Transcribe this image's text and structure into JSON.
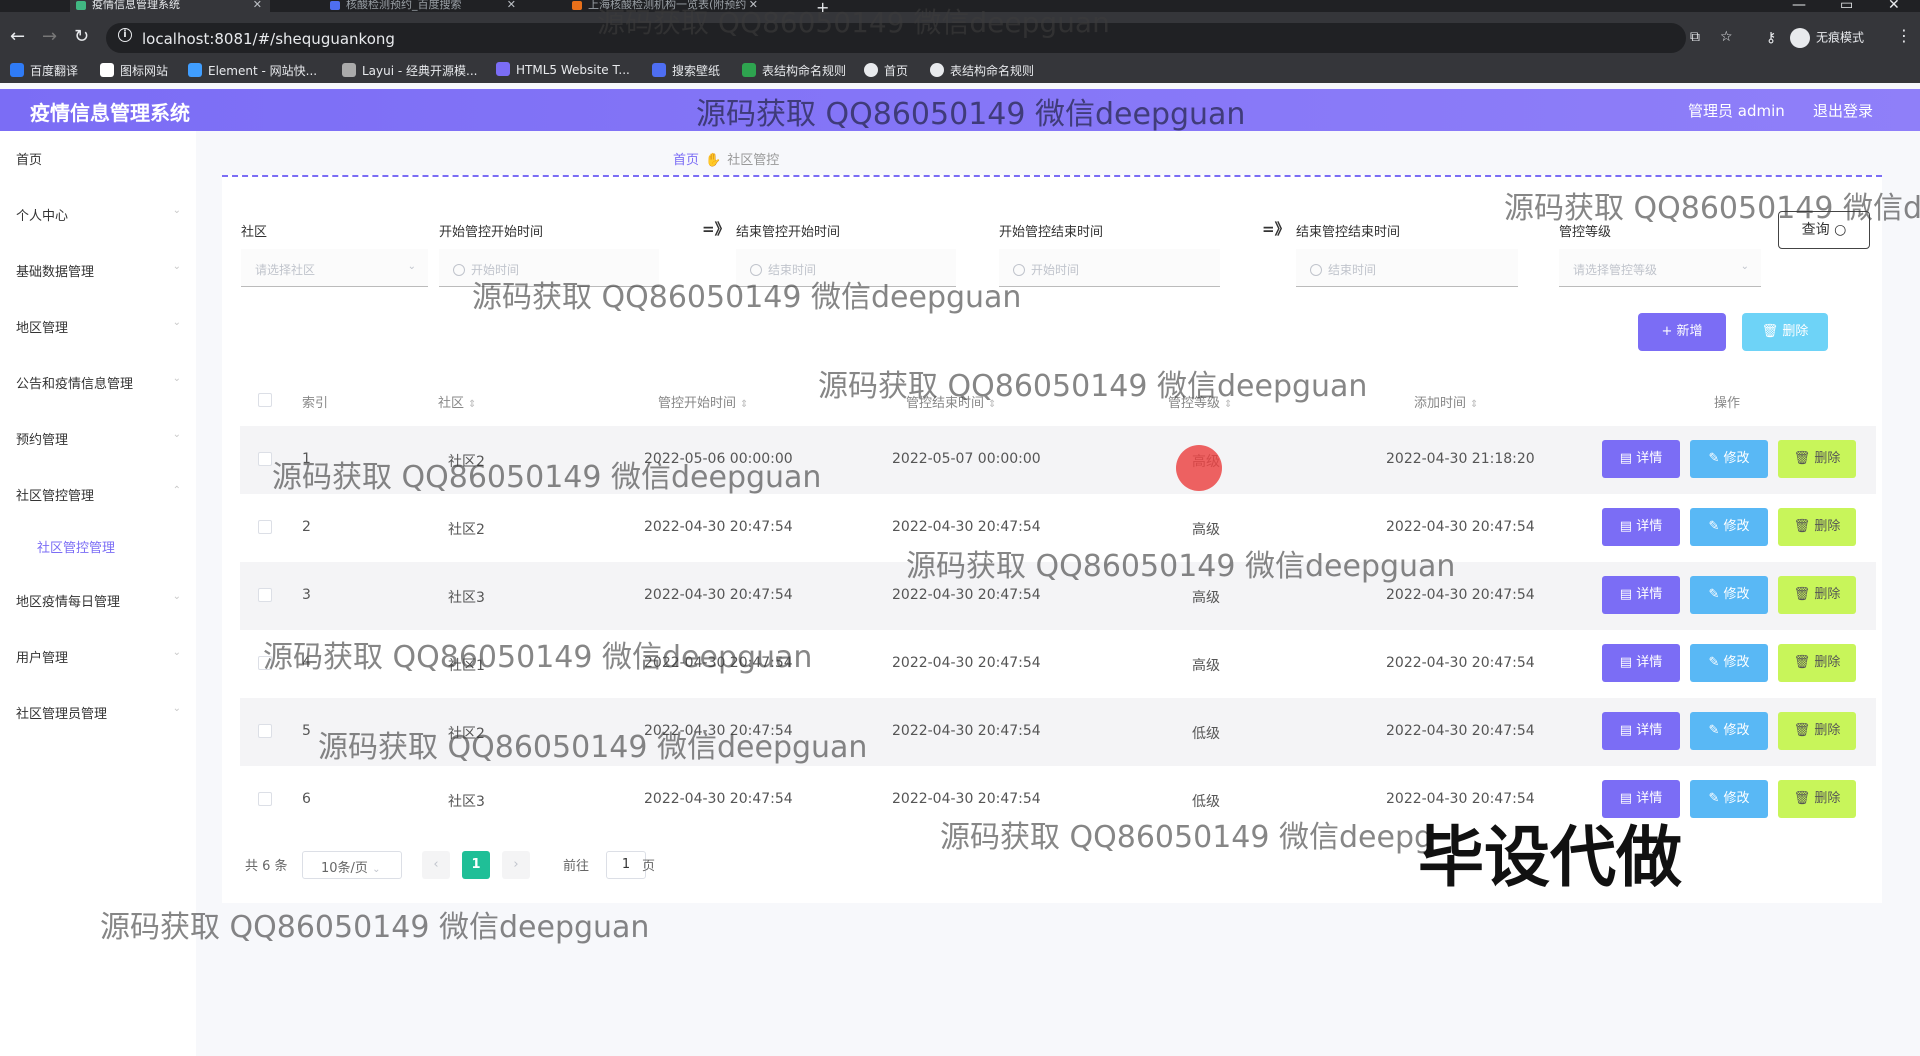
{
  "browser": {
    "tabs": [
      {
        "title": "疫情信息管理系统",
        "active": true
      },
      {
        "title": "核酸检测预约_百度搜索",
        "active": false
      },
      {
        "title": "上海核酸检测机构一览表(附预约",
        "active": false
      }
    ],
    "url": "localhost:8081/#/shequguankong",
    "incognito_label": "无痕模式",
    "bookmarks": [
      "百度翻译",
      "图标网站",
      "Element - 网站快...",
      "Layui - 经典开源模...",
      "HTML5 Website T...",
      "搜索壁纸",
      "表结构命名规则",
      "首页",
      "表结构命名规则"
    ]
  },
  "header": {
    "app_title": "疫情信息管理系统",
    "admin_label": "管理员 admin",
    "logout_label": "退出登录"
  },
  "sidebar": {
    "items": [
      "首页",
      "个人中心",
      "基础数据管理",
      "地区管理",
      "公告和疫情信息管理",
      "预约管理",
      "社区管控管理",
      "地区疫情每日管理",
      "用户管理",
      "社区管理员管理"
    ],
    "sub_item": "社区管控管理"
  },
  "breadcrumb": {
    "home": "首页",
    "current": "社区管控"
  },
  "filters": {
    "community": {
      "label": "社区",
      "placeholder": "请选择社区"
    },
    "start_from": {
      "label": "开始管控开始时间",
      "placeholder": "开始时间"
    },
    "start_to": {
      "label": "结束管控开始时间",
      "placeholder": "结束时间"
    },
    "end_from": {
      "label": "开始管控结束时间",
      "placeholder": "开始时间"
    },
    "end_to": {
      "label": "结束管控结束时间",
      "placeholder": "结束时间"
    },
    "level": {
      "label": "管控等级",
      "placeholder": "请选择管控等级"
    },
    "arrow": "=》",
    "search_label": "查询"
  },
  "actions": {
    "add": "新增",
    "delete": "删除"
  },
  "table": {
    "headers": [
      "索引",
      "社区",
      "管控开始时间",
      "管控结束时间",
      "管控等级",
      "添加时间",
      "操作"
    ],
    "rows": [
      {
        "index": "1",
        "community": "社区2",
        "start": "2022-05-06 00:00:00",
        "end": "2022-05-07 00:00:00",
        "level": "高级",
        "added": "2022-04-30 21:18:20"
      },
      {
        "index": "2",
        "community": "社区2",
        "start": "2022-04-30 20:47:54",
        "end": "2022-04-30 20:47:54",
        "level": "高级",
        "added": "2022-04-30 20:47:54"
      },
      {
        "index": "3",
        "community": "社区3",
        "start": "2022-04-30 20:47:54",
        "end": "2022-04-30 20:47:54",
        "level": "高级",
        "added": "2022-04-30 20:47:54"
      },
      {
        "index": "4",
        "community": "社区1",
        "start": "2022-04-30 20:47:54",
        "end": "2022-04-30 20:47:54",
        "level": "高级",
        "added": "2022-04-30 20:47:54"
      },
      {
        "index": "5",
        "community": "社区2",
        "start": "2022-04-30 20:47:54",
        "end": "2022-04-30 20:47:54",
        "level": "低级",
        "added": "2022-04-30 20:47:54"
      },
      {
        "index": "6",
        "community": "社区3",
        "start": "2022-04-30 20:47:54",
        "end": "2022-04-30 20:47:54",
        "level": "低级",
        "added": "2022-04-30 20:47:54"
      }
    ],
    "row_actions": {
      "detail": "详情",
      "edit": "修改",
      "delete": "删除"
    }
  },
  "pagination": {
    "total": "共 6 条",
    "page_size": "10条/页",
    "current_page": "1",
    "goto_label": "前往",
    "goto_value": "1",
    "page_suffix": "页"
  },
  "watermarks": {
    "text": "源码获取 QQ86050149 微信deepguan",
    "text_cut": "源码获取 QQ86050149 微信de",
    "text_cut2": "源码获取 QQ86050149 微信deepg",
    "big": "毕设代做"
  },
  "colors": {
    "primary": "#7b6df5",
    "info": "#59b8f5",
    "danger_light": "#c8f55a",
    "page_active": "#1fbf97"
  }
}
